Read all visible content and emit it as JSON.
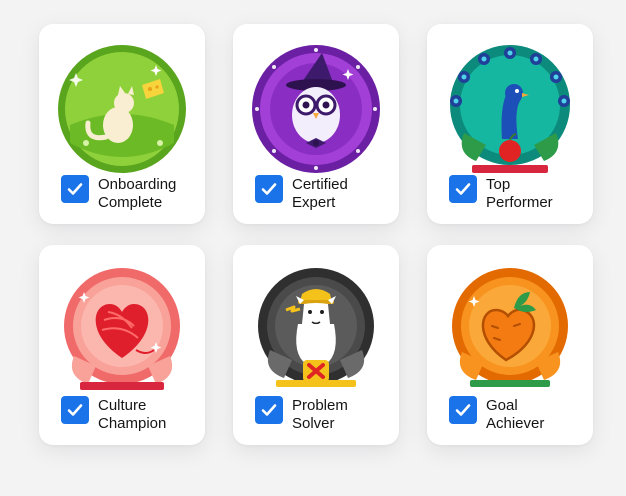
{
  "badges": [
    {
      "line1": "Onboarding",
      "line2": "Complete",
      "checked": true,
      "icon": "cat-cheese-badge-icon"
    },
    {
      "line1": "Certified",
      "line2": "Expert",
      "checked": true,
      "icon": "owl-wizard-badge-icon"
    },
    {
      "line1": "Top",
      "line2": "Performer",
      "checked": true,
      "icon": "peacock-apple-badge-icon"
    },
    {
      "line1": "Culture",
      "line2": "Champion",
      "checked": true,
      "icon": "yarn-heart-badge-icon"
    },
    {
      "line1": "Problem",
      "line2": "Solver",
      "checked": true,
      "icon": "llama-hardhat-badge-icon"
    },
    {
      "line1": "Goal",
      "line2": "Achiever",
      "checked": true,
      "icon": "carrot-heart-badge-icon"
    }
  ],
  "colors": {
    "checkbox": "#1a73e8",
    "card": "#ffffff",
    "background": "#f3f3f4"
  }
}
